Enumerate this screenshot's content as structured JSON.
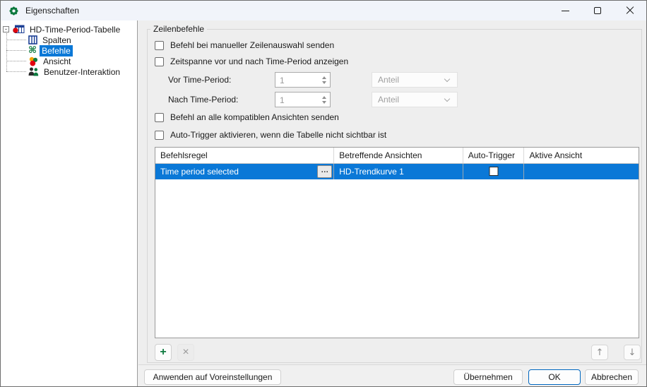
{
  "window": {
    "title": "Eigenschaften"
  },
  "tree": {
    "root": {
      "label": "HD-Time-Period-Tabelle",
      "expander_glyph": "-",
      "icon": "table-red-dot-icon"
    },
    "items": [
      {
        "label": "Spalten",
        "icon": "columns-icon",
        "selected": false
      },
      {
        "label": "Befehle",
        "icon": "command-icon",
        "glyph": "⌘",
        "selected": true
      },
      {
        "label": "Ansicht",
        "icon": "view-circles-icon",
        "selected": false
      },
      {
        "label": "Benutzer-Interaktion",
        "icon": "users-icon",
        "selected": false
      }
    ]
  },
  "content": {
    "group_title": "Zeilenbefehle",
    "checkbox_manual": {
      "label": "Befehl bei manueller Zeilenauswahl senden",
      "checked": false
    },
    "checkbox_timespan": {
      "label": "Zeitspanne vor und nach Time-Period anzeigen",
      "checked": false
    },
    "before_row": {
      "label": "Vor Time-Period:",
      "value": "1",
      "unit": "Anteil",
      "disabled": true
    },
    "after_row": {
      "label": "Nach Time-Period:",
      "value": "1",
      "unit": "Anteil",
      "disabled": true
    },
    "checkbox_all_views": {
      "label": "Befehl an alle kompatiblen Ansichten senden",
      "checked": false
    },
    "checkbox_autotrigger": {
      "label": "Auto-Trigger aktivieren, wenn die Tabelle nicht sichtbar ist",
      "checked": false
    },
    "table": {
      "headers": [
        "Befehlsregel",
        "Betreffende Ansichten",
        "Auto-Trigger",
        "Aktive Ansicht"
      ],
      "rows": [
        {
          "rule": "Time period selected",
          "ellipsis_glyph": "…",
          "views": "HD-Trendkurve 1",
          "auto_trigger": false,
          "active_view": ""
        }
      ]
    },
    "list_toolbar": {
      "add_glyph": "+",
      "remove_glyph": "×",
      "up_glyph": "↑",
      "down_glyph": "↓"
    }
  },
  "footer": {
    "apply_presets": "Anwenden auf Voreinstellungen",
    "apply": "Übernehmen",
    "ok": "OK",
    "cancel": "Abbrechen"
  }
}
